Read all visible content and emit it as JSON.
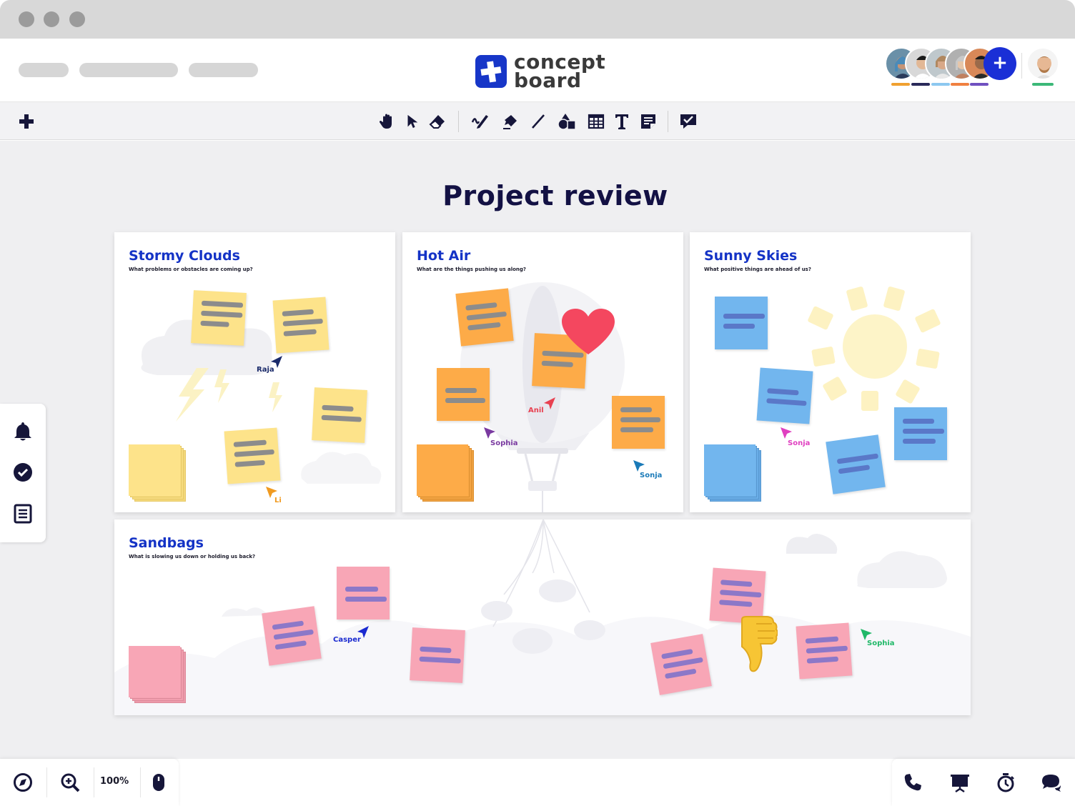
{
  "window": {
    "controls": [
      "close",
      "minimize",
      "maximize"
    ]
  },
  "header": {
    "nav_placeholders": 3,
    "logo": {
      "line1": "concept",
      "line2": "board",
      "icon": "plus-icon",
      "brand_color": "#1736c8"
    },
    "collaborators": [
      {
        "name": "user-1",
        "color": "#f0a030"
      },
      {
        "name": "user-2",
        "color": "#2a2a5a"
      },
      {
        "name": "user-3",
        "color": "#8cc8f0"
      },
      {
        "name": "user-4",
        "color": "#f08040"
      },
      {
        "name": "user-5",
        "color": "#7050c0"
      }
    ],
    "add_label": "+",
    "current_user_color": "#3cb878"
  },
  "toolbar": {
    "add_label": "+",
    "tools": [
      "hand-icon",
      "select-icon",
      "eraser-icon",
      "pen-icon",
      "marker-icon",
      "line-icon",
      "shapes-icon",
      "table-icon",
      "text-icon",
      "sticky-note-icon",
      "comment-icon"
    ]
  },
  "board": {
    "title": "Project review",
    "panels": [
      {
        "id": "stormy",
        "title": "Stormy Clouds",
        "subtitle": "What problems or obstacles are coming up?"
      },
      {
        "id": "hotair",
        "title": "Hot Air",
        "subtitle": "What are the things pushing us along?"
      },
      {
        "id": "sunny",
        "title": "Sunny Skies",
        "subtitle": "What positive things are ahead of us?"
      },
      {
        "id": "sandbags",
        "title": "Sandbags",
        "subtitle": "What is slowing us down or holding us back?"
      }
    ],
    "cursors": [
      {
        "name": "Raja",
        "color": "#1a2a6a"
      },
      {
        "name": "Li",
        "color": "#f09a20"
      },
      {
        "name": "Anil",
        "color": "#e84050"
      },
      {
        "name": "Sophia",
        "color": "#7a3aa0"
      },
      {
        "name": "Sonja",
        "color": "#1a7ab8"
      },
      {
        "name": "Sonja",
        "color": "#e040c0"
      },
      {
        "name": "Casper",
        "color": "#1a2ad0"
      },
      {
        "name": "Sophia",
        "color": "#20b868"
      }
    ],
    "note_colors": {
      "yellow": "#fde38a",
      "orange": "#fdab48",
      "blue": "#72b6ee",
      "pink": "#f8a6b6"
    }
  },
  "sidebar": {
    "items": [
      "bell-icon",
      "check-circle-icon",
      "list-icon"
    ]
  },
  "bottom_left": {
    "zoom": "100%"
  },
  "bottom_right": {
    "items": [
      "phone-icon",
      "presentation-icon",
      "timer-icon",
      "chat-icon"
    ]
  }
}
